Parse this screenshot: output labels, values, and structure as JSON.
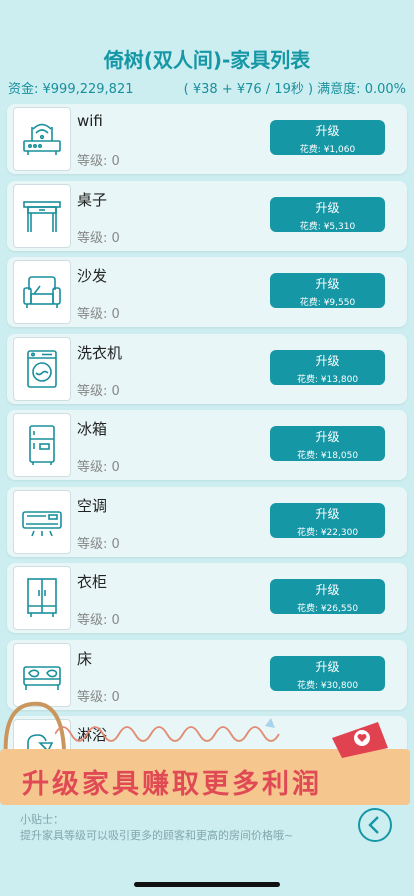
{
  "header": {
    "title": "倚树(双人间)-家具列表",
    "funds": "资金: ¥999,229,821",
    "rate": "( ¥38 + ¥76 / 19秒 ) 满意度: 0.00%"
  },
  "items": [
    {
      "name": "wifi",
      "level": "等级: 0",
      "button": "升级",
      "cost": "花费: ¥1,060",
      "icon": "router-icon"
    },
    {
      "name": "桌子",
      "level": "等级: 0",
      "button": "升级",
      "cost": "花费: ¥5,310",
      "icon": "table-icon"
    },
    {
      "name": "沙发",
      "level": "等级: 0",
      "button": "升级",
      "cost": "花费: ¥9,550",
      "icon": "sofa-icon"
    },
    {
      "name": "洗衣机",
      "level": "等级: 0",
      "button": "升级",
      "cost": "花费: ¥13,800",
      "icon": "washing-machine-icon"
    },
    {
      "name": "冰箱",
      "level": "等级: 0",
      "button": "升级",
      "cost": "花费: ¥18,050",
      "icon": "fridge-icon"
    },
    {
      "name": "空调",
      "level": "等级: 0",
      "button": "升级",
      "cost": "花费: ¥22,300",
      "icon": "air-conditioner-icon"
    },
    {
      "name": "衣柜",
      "level": "等级: 0",
      "button": "升级",
      "cost": "花费: ¥26,550",
      "icon": "wardrobe-icon"
    },
    {
      "name": "床",
      "level": "等级: 0",
      "button": "升级",
      "cost": "花费: ¥30,800",
      "icon": "bed-icon"
    },
    {
      "name": "淋浴",
      "level": "",
      "button": "",
      "cost": "",
      "icon": "shower-icon"
    }
  ],
  "banner": {
    "text": "升级家具赚取更多利润"
  },
  "tips": {
    "label": "小贴士：",
    "text": "提升家具等级可以吸引更多的顾客和更高的房间价格哦~"
  },
  "colors": {
    "accent": "#1597a6",
    "background": "#cdeef1",
    "banner": "#f6c68f",
    "banner_text": "#e04a55"
  }
}
